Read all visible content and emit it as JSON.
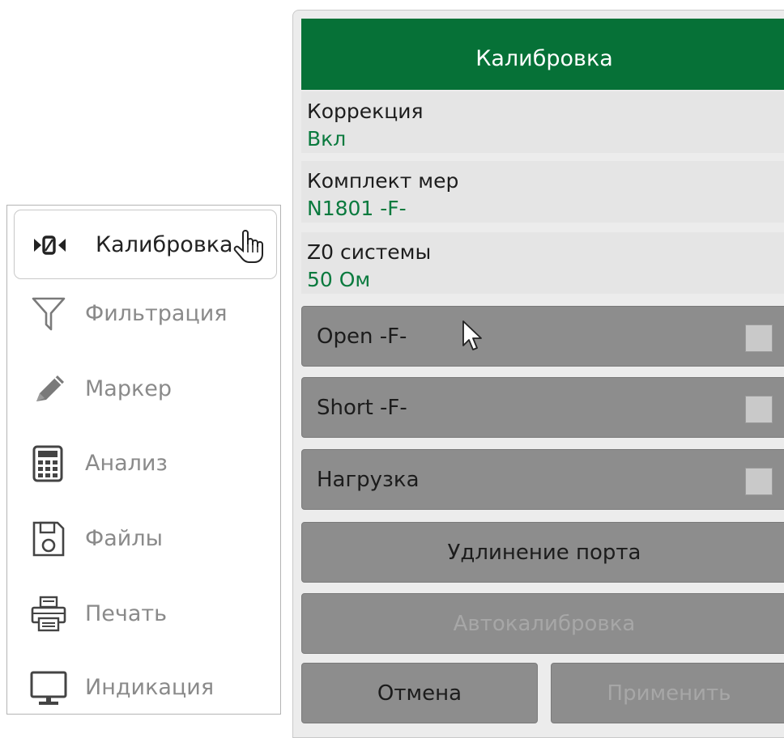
{
  "menu": {
    "items": [
      {
        "label": "Калибровка",
        "icon": "calibration-icon",
        "active": true
      },
      {
        "label": "Фильтрация",
        "icon": "filter-icon"
      },
      {
        "label": "Маркер",
        "icon": "marker-pencil-icon"
      },
      {
        "label": "Анализ",
        "icon": "calculator-icon"
      },
      {
        "label": "Файлы",
        "icon": "floppy-disk-icon"
      },
      {
        "label": "Печать",
        "icon": "printer-icon"
      },
      {
        "label": "Индикация",
        "icon": "monitor-icon"
      }
    ]
  },
  "panel": {
    "title": "Калибровка",
    "correction": {
      "label": "Коррекция",
      "value": "Вкл"
    },
    "cal_kit": {
      "label": "Комплект мер",
      "value": "N1801 -F-"
    },
    "z0": {
      "label": "Z0 системы",
      "value": "50 Ом"
    },
    "open": {
      "label": "Open -F-",
      "checked": false
    },
    "short": {
      "label": "Short -F-",
      "checked": false
    },
    "load": {
      "label": "Нагрузка",
      "checked": false
    },
    "port_extension": "Удлинение порта",
    "autocal": "Автокалибровка",
    "cancel": "Отмена",
    "apply": "Применить"
  },
  "colors": {
    "header_bg": "#067137",
    "value_text": "#0a7a3e",
    "button_bg": "#8d8d8d",
    "panel_bg": "#ececec"
  }
}
